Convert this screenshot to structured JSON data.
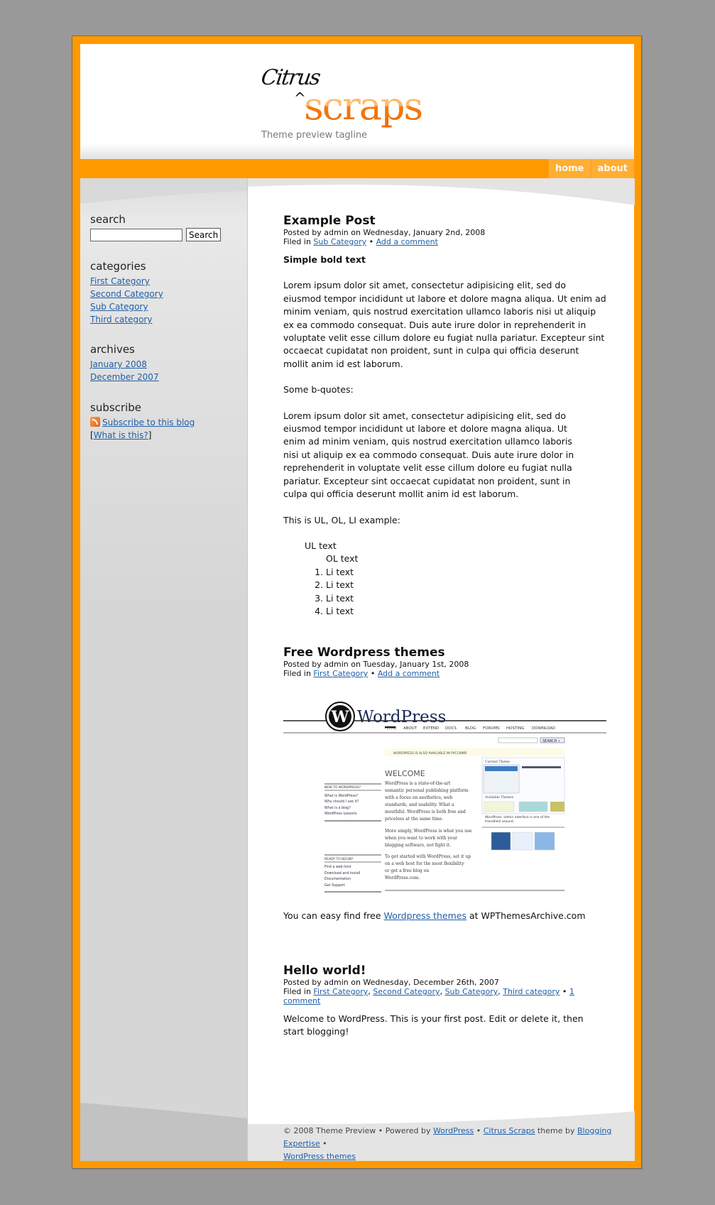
{
  "header": {
    "logo_part1": "Citrus",
    "logo_caret": "^",
    "logo_part2": "scraps",
    "tagline": "Theme preview tagline"
  },
  "nav": {
    "items": [
      {
        "label": "home"
      },
      {
        "label": "about"
      }
    ]
  },
  "sidebar": {
    "search": {
      "heading": "search",
      "input_value": "",
      "button_label": "Search"
    },
    "categories": {
      "heading": "categories",
      "items": [
        "First Category",
        "Second Category",
        "Sub Category",
        "Third category"
      ]
    },
    "archives": {
      "heading": "archives",
      "items": [
        "January 2008",
        "December 2007"
      ]
    },
    "subscribe": {
      "heading": "subscribe",
      "rss_icon": "rss-feed-icon",
      "link": "Subscribe to this blog",
      "bracket_open": "[",
      "what_link": "What is this?",
      "bracket_close": "]"
    }
  },
  "posts": [
    {
      "title": "Example Post",
      "posted": "Posted by admin on Wednesday, January 2nd, 2008",
      "filed_prefix": "Filed in ",
      "categories": [
        "Sub Category"
      ],
      "separator": " • ",
      "comment_link": "Add a comment",
      "bold_text": "Simple bold text",
      "paragraph": "Lorem ipsum dolor sit amet, consectetur adipisicing elit, sed do eiusmod tempor incididunt ut labore et dolore magna aliqua. Ut enim ad minim veniam, quis nostrud exercitation ullamco laboris nisi ut aliquip ex ea commodo consequat. Duis aute irure dolor in reprehenderit in voluptate velit esse cillum dolore eu fugiat nulla pariatur. Excepteur sint occaecat cupidatat non proident, sunt in culpa qui officia deserunt mollit anim id est laborum.",
      "bquote_intro": "Some b-quotes:",
      "blockquote": "Lorem ipsum dolor sit amet, consectetur adipisicing elit, sed do eiusmod tempor incididunt ut labore et dolore magna aliqua. Ut enim ad minim veniam, quis nostrud exercitation ullamco laboris nisi ut aliquip ex ea commodo consequat. Duis aute irure dolor in reprehenderit in voluptate velit esse cillum dolore eu fugiat nulla pariatur. Excepteur sint occaecat cupidatat non proident, sunt in culpa qui officia deserunt mollit anim id est laborum.",
      "list_intro": "This is UL, OL, LI example:",
      "ul_text": "UL text",
      "ol_text": "OL text",
      "li_items": [
        "Li text",
        "Li text",
        "Li text",
        "Li text"
      ]
    },
    {
      "title": "Free Wordpress themes",
      "posted": "Posted by admin on Tuesday, January 1st, 2008",
      "filed_prefix": "Filed in ",
      "categories": [
        "First Category"
      ],
      "separator": " • ",
      "comment_link": "Add a comment",
      "screenshot": {
        "brand": "WordPress",
        "nav": [
          "HOME",
          "ABOUT",
          "EXTEND",
          "DOCS",
          "BLOG",
          "FORUMS",
          "HOSTING",
          "DOWNLOAD"
        ],
        "search_button": "SEARCH »",
        "notice": "WORDPRESS IS ALSO AVAILABLE IN РУССКИЙ.",
        "welcome": "WELCOME",
        "intro": "WordPress is a state-of-the-art semantic personal publishing platform with a focus on aesthetics, web standards, and usability. What a mouthful. WordPress is both free and priceless at the same time.",
        "simply": "More simply, WordPress is what you use when you want to work with your blogging software, not fight it.",
        "started": "To get started with WordPress, set it up on a web host for the most flexibility or get a free blog on WordPress.com.",
        "new_heading": "NEW TO WORDPRESS?",
        "new_links": [
          "What is WordPress?",
          "Why should I use it?",
          "What is a blog?",
          "WordPress Lessons"
        ],
        "ready_heading": "READY TO BEGIN?",
        "ready_links": [
          "Find a web host",
          "Download and Install",
          "Documentation",
          "Get Support"
        ],
        "current_theme": "Current Theme",
        "available_themes": "Available Themes",
        "caption": "WordPress' admin interface is one of the friendliest around."
      },
      "text_before": "You can easy find free ",
      "text_link": "Wordpress themes",
      "text_after": " at WPThemesArchive.com"
    },
    {
      "title": "Hello world!",
      "posted": "Posted by admin on Wednesday, December 26th, 2007",
      "filed_prefix": "Filed in ",
      "categories": [
        "First Category",
        "Second Category",
        "Sub Category",
        "Third category"
      ],
      "separator": " • ",
      "comment_link": "1 comment",
      "paragraph": "Welcome to WordPress. This is your first post. Edit or delete it, then start blogging!"
    }
  ],
  "footer": {
    "copyright": "© 2008 Theme Preview • Powered by ",
    "wordpress_link": "WordPress",
    "sep1": " • ",
    "theme_link": "Citrus Scraps",
    "theme_by": " theme by ",
    "author_link": "Blogging Expertise",
    "sep2": " • ",
    "themes_link": "WordPress themes"
  },
  "colors": {
    "accent_orange": "#ff9900",
    "link_blue": "#1f5fa8",
    "logo_orange": "#f47a10"
  }
}
